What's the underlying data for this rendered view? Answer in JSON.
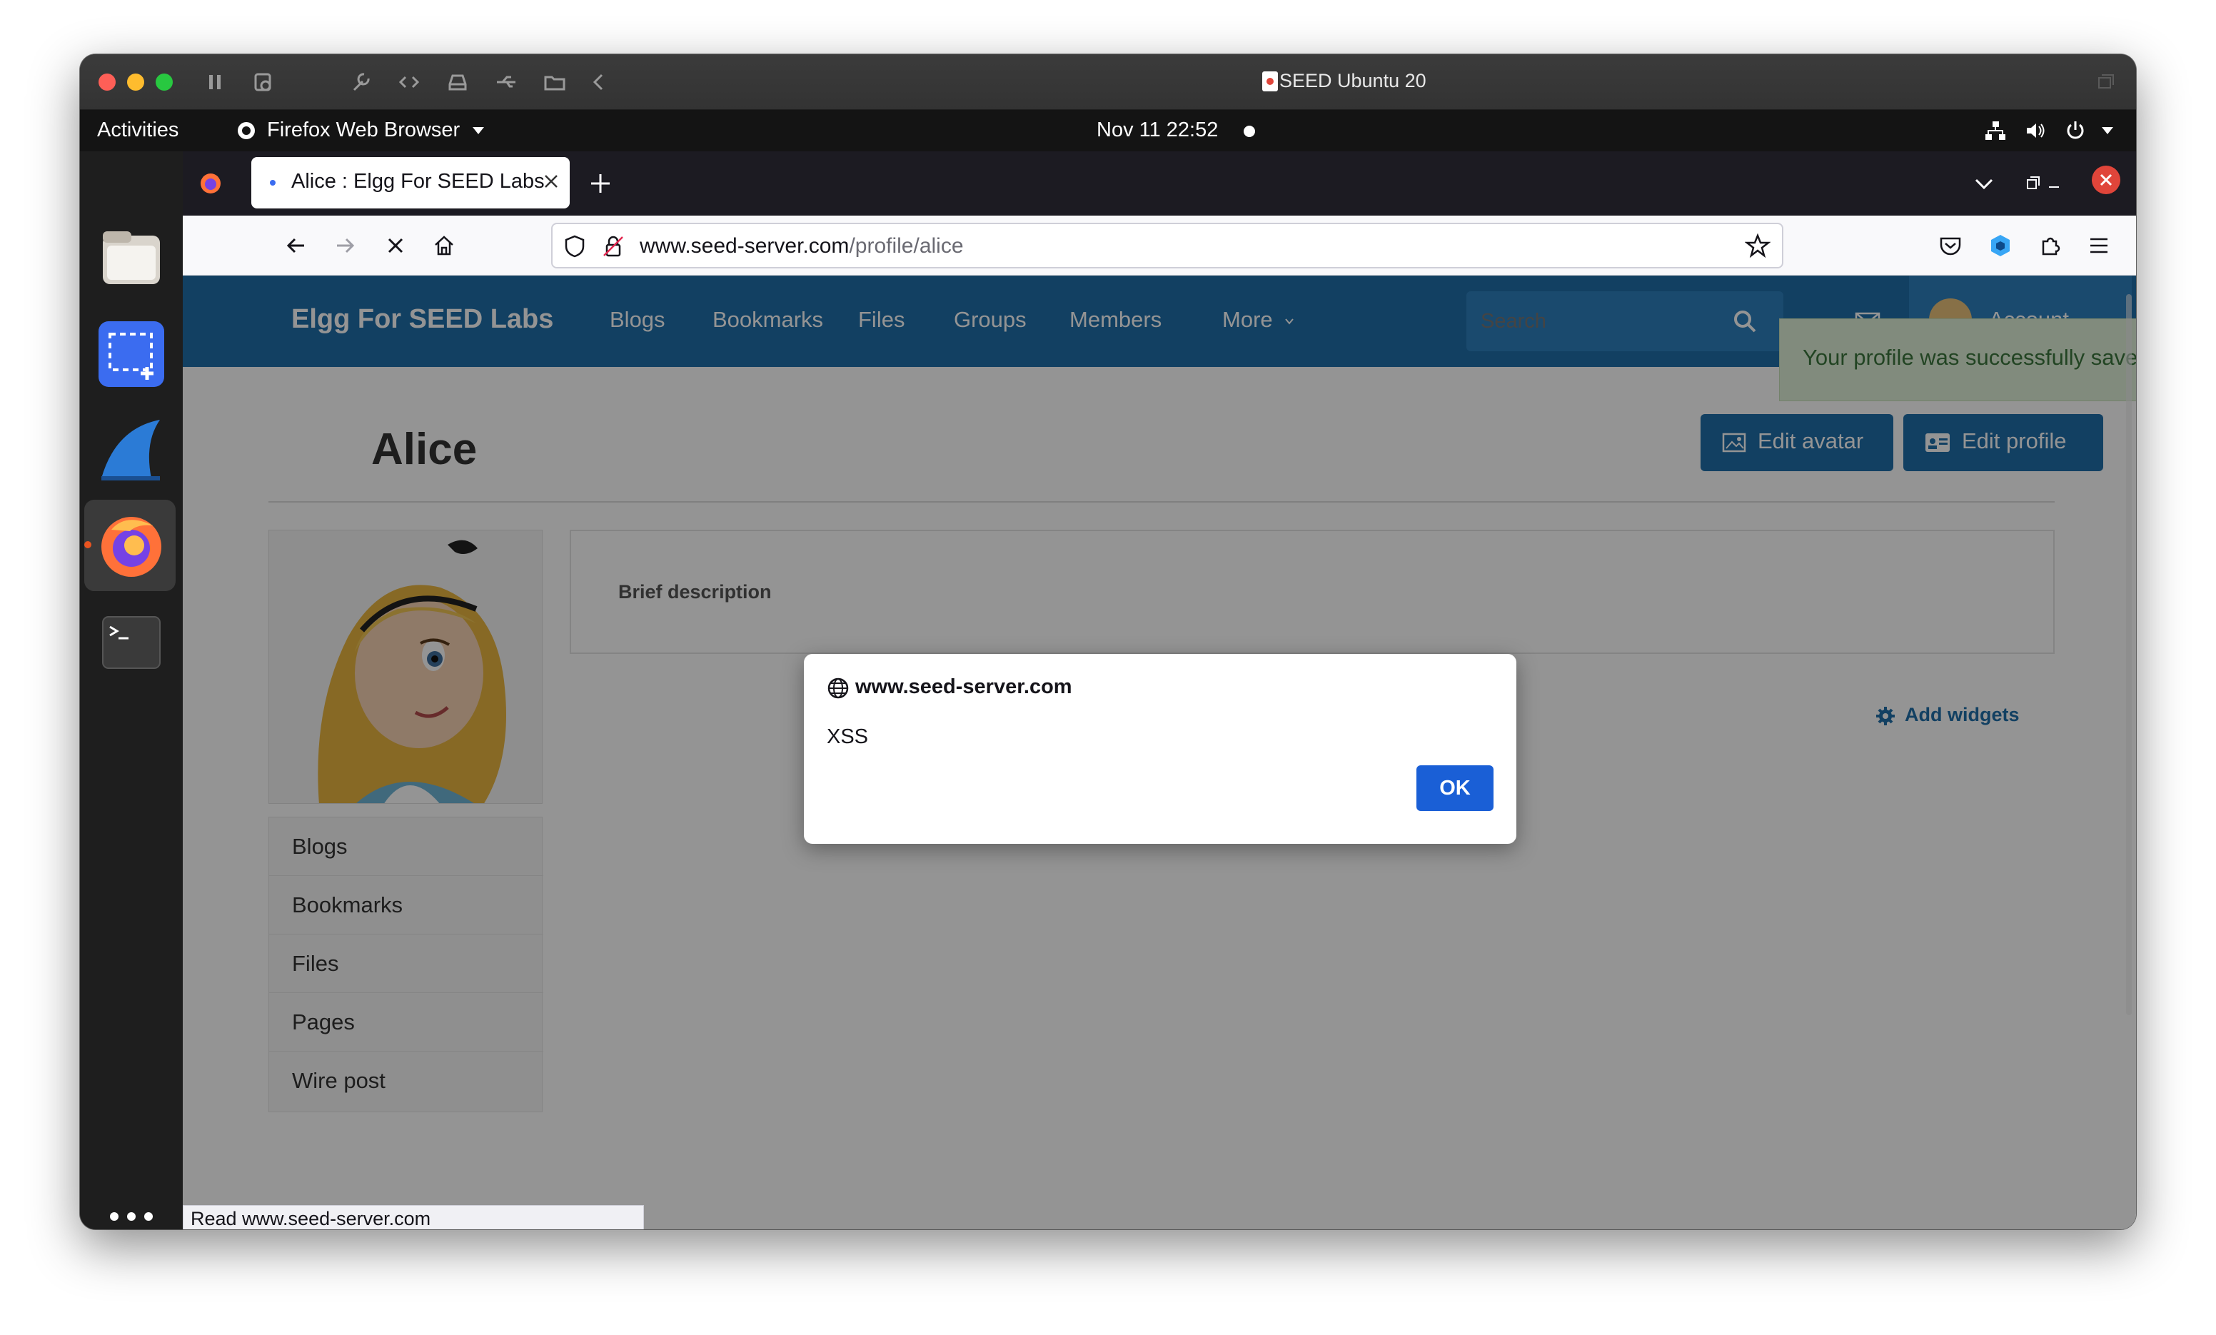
{
  "vm": {
    "title": "SEED Ubuntu 20"
  },
  "ubuntu": {
    "activities": "Activities",
    "app_menu": "Firefox Web Browser",
    "clock": "Nov 11  22:52"
  },
  "firefox": {
    "tab_title": "Alice : Elgg For SEED Labs",
    "url_domain": "www.seed-server.com",
    "url_path": "/profile/alice",
    "status_text": "Read www.seed-server.com"
  },
  "elgg": {
    "site_name": "Elgg For SEED Labs",
    "nav": [
      "Blogs",
      "Bookmarks",
      "Files",
      "Groups",
      "Members",
      "More"
    ],
    "search_placeholder": "Search",
    "account_label": "Account",
    "toast": "Your profile was successfully saved.",
    "profile_name": "Alice",
    "edit_avatar_label": "Edit avatar",
    "edit_profile_label": "Edit profile",
    "brief_description_label": "Brief description",
    "add_widgets_label": "Add widgets",
    "sidebar_menu": [
      "Blogs",
      "Bookmarks",
      "Files",
      "Pages",
      "Wire post"
    ]
  },
  "alert": {
    "origin": "www.seed-server.com",
    "message": "XSS",
    "ok_label": "OK"
  },
  "colors": {
    "elgg_blue": "#1f6ea9",
    "dialog_button": "#1a5fd6",
    "toast_bg": "#dff0d8"
  }
}
